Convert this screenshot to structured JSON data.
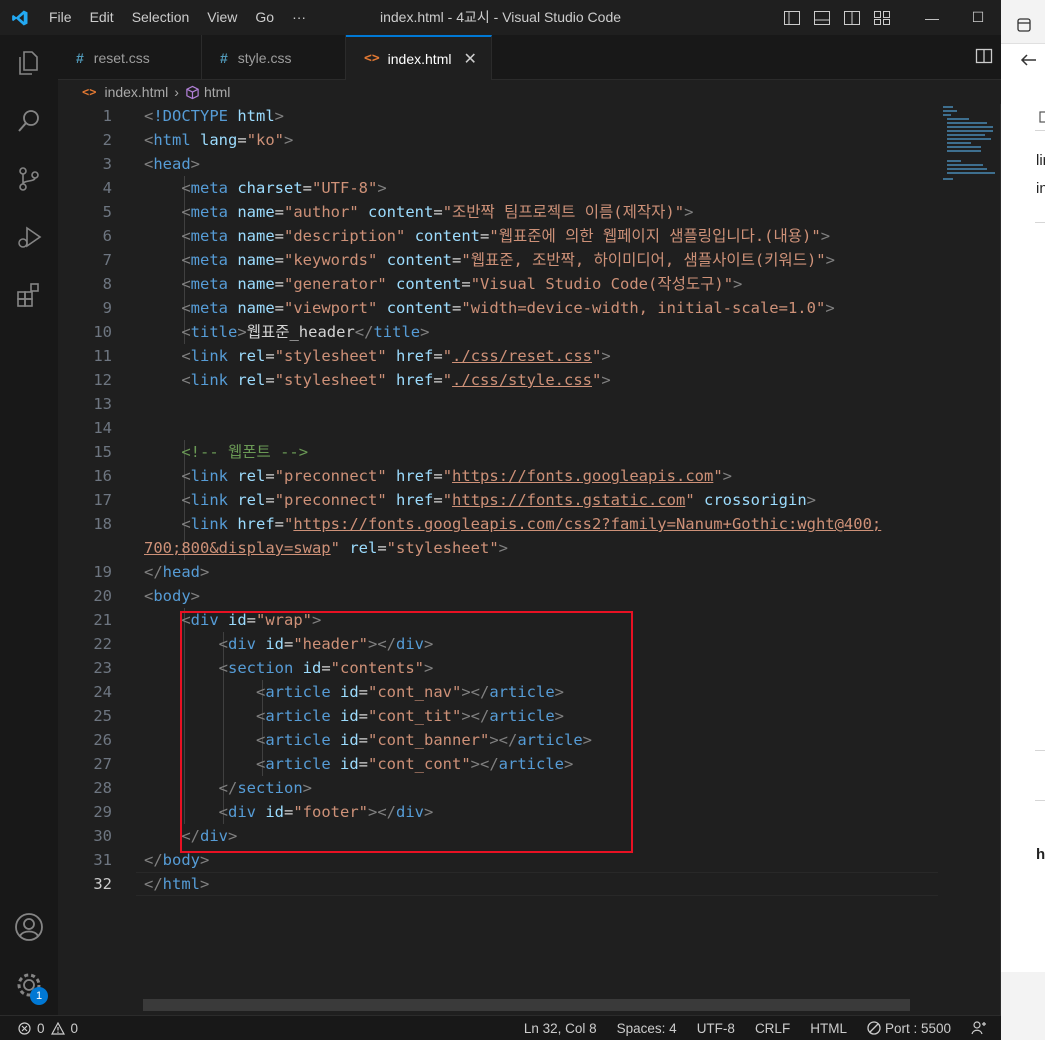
{
  "window": {
    "title": "index.html - 4교시 - Visual Studio Code",
    "menu": [
      "File",
      "Edit",
      "Selection",
      "View",
      "Go",
      "···"
    ],
    "controls": [
      "—",
      "☐"
    ]
  },
  "tabs": [
    {
      "label": "reset.css",
      "icon": "css-hash-icon"
    },
    {
      "label": "style.css",
      "icon": "css-hash-icon"
    },
    {
      "label": "index.html",
      "icon": "html-icon",
      "close": "✕"
    }
  ],
  "breadcrumb": {
    "file": "index.html",
    "sep": "›",
    "symbol": "html"
  },
  "editor": {
    "lines": [
      {
        "n": "1",
        "tokens": [
          [
            "br",
            "<"
          ],
          [
            "tag",
            "!DOCTYPE "
          ],
          [
            "attr",
            "html"
          ],
          [
            "br",
            ">"
          ]
        ]
      },
      {
        "n": "2",
        "tokens": [
          [
            "br",
            "<"
          ],
          [
            "tag",
            "html "
          ],
          [
            "attr",
            "lang"
          ],
          [
            "txt",
            "="
          ],
          [
            "str",
            "\"ko\""
          ],
          [
            "br",
            ">"
          ]
        ]
      },
      {
        "n": "3",
        "tokens": [
          [
            "br",
            "<"
          ],
          [
            "tag",
            "head"
          ],
          [
            "br",
            ">"
          ]
        ]
      },
      {
        "n": "4",
        "tokens": [
          [
            "txt",
            "    "
          ],
          [
            "br",
            "<"
          ],
          [
            "tag",
            "meta "
          ],
          [
            "attr",
            "charset"
          ],
          [
            "txt",
            "="
          ],
          [
            "str",
            "\"UTF-8\""
          ],
          [
            "br",
            ">"
          ]
        ]
      },
      {
        "n": "5",
        "tokens": [
          [
            "txt",
            "    "
          ],
          [
            "br",
            "<"
          ],
          [
            "tag",
            "meta "
          ],
          [
            "attr",
            "name"
          ],
          [
            "txt",
            "="
          ],
          [
            "str",
            "\"author\""
          ],
          [
            "txt",
            " "
          ],
          [
            "attr",
            "content"
          ],
          [
            "txt",
            "="
          ],
          [
            "str",
            "\"조반짝 팀프로젝트 이름(제작자)\""
          ],
          [
            "br",
            ">"
          ]
        ]
      },
      {
        "n": "6",
        "tokens": [
          [
            "txt",
            "    "
          ],
          [
            "br",
            "<"
          ],
          [
            "tag",
            "meta "
          ],
          [
            "attr",
            "name"
          ],
          [
            "txt",
            "="
          ],
          [
            "str",
            "\"description\""
          ],
          [
            "txt",
            " "
          ],
          [
            "attr",
            "content"
          ],
          [
            "txt",
            "="
          ],
          [
            "str",
            "\"웹표준에 의한 웹페이지 샘플링입니다.(내용)\""
          ],
          [
            "br",
            ">"
          ]
        ]
      },
      {
        "n": "7",
        "tokens": [
          [
            "txt",
            "    "
          ],
          [
            "br",
            "<"
          ],
          [
            "tag",
            "meta "
          ],
          [
            "attr",
            "name"
          ],
          [
            "txt",
            "="
          ],
          [
            "str",
            "\"keywords\""
          ],
          [
            "txt",
            " "
          ],
          [
            "attr",
            "content"
          ],
          [
            "txt",
            "="
          ],
          [
            "str",
            "\"웹표준, 조반짝, 하이미디어, 샘플사이트(키워드)\""
          ],
          [
            "br",
            ">"
          ]
        ]
      },
      {
        "n": "8",
        "tokens": [
          [
            "txt",
            "    "
          ],
          [
            "br",
            "<"
          ],
          [
            "tag",
            "meta "
          ],
          [
            "attr",
            "name"
          ],
          [
            "txt",
            "="
          ],
          [
            "str",
            "\"generator\""
          ],
          [
            "txt",
            " "
          ],
          [
            "attr",
            "content"
          ],
          [
            "txt",
            "="
          ],
          [
            "str",
            "\"Visual Studio Code(작성도구)\""
          ],
          [
            "br",
            ">"
          ]
        ]
      },
      {
        "n": "9",
        "tokens": [
          [
            "txt",
            "    "
          ],
          [
            "br",
            "<"
          ],
          [
            "tag",
            "meta "
          ],
          [
            "attr",
            "name"
          ],
          [
            "txt",
            "="
          ],
          [
            "str",
            "\"viewport\""
          ],
          [
            "txt",
            " "
          ],
          [
            "attr",
            "content"
          ],
          [
            "txt",
            "="
          ],
          [
            "str",
            "\"width=device-width, initial-scale=1.0\""
          ],
          [
            "br",
            ">"
          ]
        ]
      },
      {
        "n": "10",
        "tokens": [
          [
            "txt",
            "    "
          ],
          [
            "br",
            "<"
          ],
          [
            "tag",
            "title"
          ],
          [
            "br",
            ">"
          ],
          [
            "txt",
            "웹표준_header"
          ],
          [
            "br",
            "</"
          ],
          [
            "tag",
            "title"
          ],
          [
            "br",
            ">"
          ]
        ]
      },
      {
        "n": "11",
        "tokens": [
          [
            "txt",
            "    "
          ],
          [
            "br",
            "<"
          ],
          [
            "tag",
            "link "
          ],
          [
            "attr",
            "rel"
          ],
          [
            "txt",
            "="
          ],
          [
            "str",
            "\"stylesheet\""
          ],
          [
            "txt",
            " "
          ],
          [
            "attr",
            "href"
          ],
          [
            "txt",
            "="
          ],
          [
            "str",
            "\""
          ],
          [
            "link",
            "./css/reset.css"
          ],
          [
            "str",
            "\""
          ],
          [
            "br",
            ">"
          ]
        ]
      },
      {
        "n": "12",
        "tokens": [
          [
            "txt",
            "    "
          ],
          [
            "br",
            "<"
          ],
          [
            "tag",
            "link "
          ],
          [
            "attr",
            "rel"
          ],
          [
            "txt",
            "="
          ],
          [
            "str",
            "\"stylesheet\""
          ],
          [
            "txt",
            " "
          ],
          [
            "attr",
            "href"
          ],
          [
            "txt",
            "="
          ],
          [
            "str",
            "\""
          ],
          [
            "link",
            "./css/style.css"
          ],
          [
            "str",
            "\""
          ],
          [
            "br",
            ">"
          ]
        ]
      },
      {
        "n": "13",
        "tokens": []
      },
      {
        "n": "14",
        "tokens": []
      },
      {
        "n": "15",
        "tokens": [
          [
            "txt",
            "    "
          ],
          [
            "cmt",
            "<!-- 웹폰트 -->"
          ]
        ]
      },
      {
        "n": "16",
        "tokens": [
          [
            "txt",
            "    "
          ],
          [
            "br",
            "<"
          ],
          [
            "tag",
            "link "
          ],
          [
            "attr",
            "rel"
          ],
          [
            "txt",
            "="
          ],
          [
            "str",
            "\"preconnect\""
          ],
          [
            "txt",
            " "
          ],
          [
            "attr",
            "href"
          ],
          [
            "txt",
            "="
          ],
          [
            "str",
            "\""
          ],
          [
            "link",
            "https://fonts.googleapis.com"
          ],
          [
            "str",
            "\""
          ],
          [
            "br",
            ">"
          ]
        ]
      },
      {
        "n": "17",
        "tokens": [
          [
            "txt",
            "    "
          ],
          [
            "br",
            "<"
          ],
          [
            "tag",
            "link "
          ],
          [
            "attr",
            "rel"
          ],
          [
            "txt",
            "="
          ],
          [
            "str",
            "\"preconnect\""
          ],
          [
            "txt",
            " "
          ],
          [
            "attr",
            "href"
          ],
          [
            "txt",
            "="
          ],
          [
            "str",
            "\""
          ],
          [
            "link",
            "https://fonts.gstatic.com"
          ],
          [
            "str",
            "\""
          ],
          [
            "txt",
            " "
          ],
          [
            "attr",
            "crossorigin"
          ],
          [
            "br",
            ">"
          ]
        ]
      },
      {
        "n": "18",
        "tokens": [
          [
            "txt",
            "    "
          ],
          [
            "br",
            "<"
          ],
          [
            "tag",
            "link "
          ],
          [
            "attr",
            "href"
          ],
          [
            "txt",
            "="
          ],
          [
            "str",
            "\""
          ],
          [
            "link",
            "https://fonts.googleapis.com/css2?family=Nanum+Gothic:wght@400;"
          ]
        ]
      },
      {
        "n": "",
        "tokens": [
          [
            "link",
            "700;800&display=swap"
          ],
          [
            "str",
            "\""
          ],
          [
            "txt",
            " "
          ],
          [
            "attr",
            "rel"
          ],
          [
            "txt",
            "="
          ],
          [
            "str",
            "\"stylesheet\""
          ],
          [
            "br",
            ">"
          ]
        ]
      },
      {
        "n": "19",
        "tokens": [
          [
            "br",
            "</"
          ],
          [
            "tag",
            "head"
          ],
          [
            "br",
            ">"
          ]
        ]
      },
      {
        "n": "20",
        "tokens": [
          [
            "br",
            "<"
          ],
          [
            "tag",
            "body"
          ],
          [
            "br",
            ">"
          ]
        ]
      },
      {
        "n": "21",
        "tokens": [
          [
            "txt",
            "    "
          ],
          [
            "br",
            "<"
          ],
          [
            "tag",
            "div "
          ],
          [
            "attr",
            "id"
          ],
          [
            "txt",
            "="
          ],
          [
            "str",
            "\"wrap\""
          ],
          [
            "br",
            ">"
          ]
        ]
      },
      {
        "n": "22",
        "tokens": [
          [
            "txt",
            "        "
          ],
          [
            "br",
            "<"
          ],
          [
            "tag",
            "div "
          ],
          [
            "attr",
            "id"
          ],
          [
            "txt",
            "="
          ],
          [
            "str",
            "\"header\""
          ],
          [
            "br",
            "></"
          ],
          [
            "tag",
            "div"
          ],
          [
            "br",
            ">"
          ]
        ]
      },
      {
        "n": "23",
        "tokens": [
          [
            "txt",
            "        "
          ],
          [
            "br",
            "<"
          ],
          [
            "tag",
            "section "
          ],
          [
            "attr",
            "id"
          ],
          [
            "txt",
            "="
          ],
          [
            "str",
            "\"contents\""
          ],
          [
            "br",
            ">"
          ]
        ]
      },
      {
        "n": "24",
        "tokens": [
          [
            "txt",
            "            "
          ],
          [
            "br",
            "<"
          ],
          [
            "tag",
            "article "
          ],
          [
            "attr",
            "id"
          ],
          [
            "txt",
            "="
          ],
          [
            "str",
            "\"cont_nav\""
          ],
          [
            "br",
            "></"
          ],
          [
            "tag",
            "article"
          ],
          [
            "br",
            ">"
          ]
        ]
      },
      {
        "n": "25",
        "tokens": [
          [
            "txt",
            "            "
          ],
          [
            "br",
            "<"
          ],
          [
            "tag",
            "article "
          ],
          [
            "attr",
            "id"
          ],
          [
            "txt",
            "="
          ],
          [
            "str",
            "\"cont_tit\""
          ],
          [
            "br",
            "></"
          ],
          [
            "tag",
            "article"
          ],
          [
            "br",
            ">"
          ]
        ]
      },
      {
        "n": "26",
        "tokens": [
          [
            "txt",
            "            "
          ],
          [
            "br",
            "<"
          ],
          [
            "tag",
            "article "
          ],
          [
            "attr",
            "id"
          ],
          [
            "txt",
            "="
          ],
          [
            "str",
            "\"cont_banner\""
          ],
          [
            "br",
            "></"
          ],
          [
            "tag",
            "article"
          ],
          [
            "br",
            ">"
          ]
        ]
      },
      {
        "n": "27",
        "tokens": [
          [
            "txt",
            "            "
          ],
          [
            "br",
            "<"
          ],
          [
            "tag",
            "article "
          ],
          [
            "attr",
            "id"
          ],
          [
            "txt",
            "="
          ],
          [
            "str",
            "\"cont_cont\""
          ],
          [
            "br",
            "></"
          ],
          [
            "tag",
            "article"
          ],
          [
            "br",
            ">"
          ]
        ]
      },
      {
        "n": "28",
        "tokens": [
          [
            "txt",
            "        "
          ],
          [
            "br",
            "</"
          ],
          [
            "tag",
            "section"
          ],
          [
            "br",
            ">"
          ]
        ]
      },
      {
        "n": "29",
        "tokens": [
          [
            "txt",
            "        "
          ],
          [
            "br",
            "<"
          ],
          [
            "tag",
            "div "
          ],
          [
            "attr",
            "id"
          ],
          [
            "txt",
            "="
          ],
          [
            "str",
            "\"footer\""
          ],
          [
            "br",
            "></"
          ],
          [
            "tag",
            "div"
          ],
          [
            "br",
            ">"
          ]
        ]
      },
      {
        "n": "30",
        "tokens": [
          [
            "txt",
            "    "
          ],
          [
            "br",
            "</"
          ],
          [
            "tag",
            "div"
          ],
          [
            "br",
            ">"
          ]
        ]
      },
      {
        "n": "31",
        "tokens": [
          [
            "br",
            "</"
          ],
          [
            "tag",
            "body"
          ],
          [
            "br",
            ">"
          ]
        ]
      },
      {
        "n": "32",
        "tokens": [
          [
            "br",
            "</"
          ],
          [
            "tag",
            "html"
          ],
          [
            "br",
            ">"
          ]
        ],
        "current": true
      }
    ]
  },
  "activity": {
    "settings_badge": "1"
  },
  "status": {
    "errors": "0",
    "warnings": "0",
    "position": "Ln 32, Col 8",
    "spaces": "Spaces: 4",
    "encoding": "UTF-8",
    "eol": "CRLF",
    "language": "HTML",
    "port": "Port : 5500"
  },
  "side_panel": {
    "texts": [
      "lir",
      "in",
      "h"
    ]
  },
  "colors": {
    "accent": "#0078d4",
    "highlight_box": "#e81123"
  }
}
